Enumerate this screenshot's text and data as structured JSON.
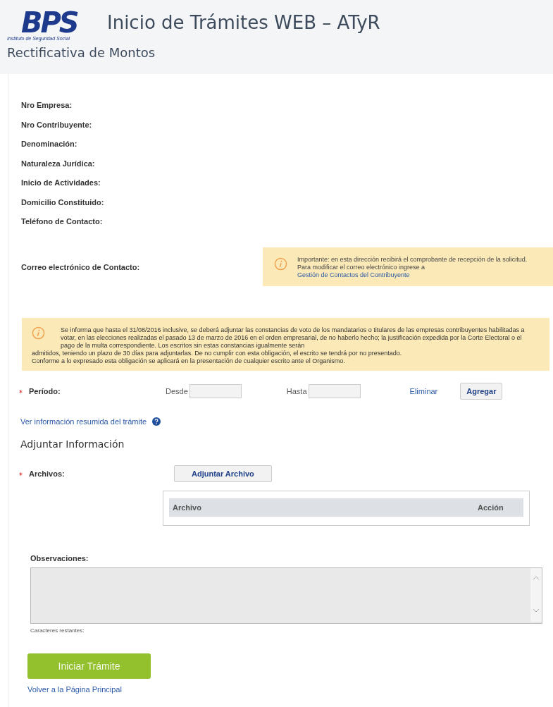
{
  "header": {
    "logo_text": "BPS",
    "logo_subtitle": "Instituto de Seguridad Social",
    "title": "Inicio de Trámites WEB – ATyR",
    "subtitle": "Rectificativa de Montos"
  },
  "fields": [
    {
      "label": "Nro Empresa:"
    },
    {
      "label": "Nro Contribuyente:"
    },
    {
      "label": "Denominación:"
    },
    {
      "label": "Naturaleza Jurídica:"
    },
    {
      "label": "Inicio de Actividades:"
    },
    {
      "label": "Domicilio Constituido:"
    },
    {
      "label": "Teléfono de Contacto:"
    }
  ],
  "email": {
    "label": "Correo electrónico de Contacto:",
    "notice": "Importante: en esta dirección recibirá el comprobante de recepción de la solicitud. Para modificar el correo electrónico ingrese a",
    "notice_link": "Gestión de Contactos del Contribuyente"
  },
  "warning": [
    "Se informa que hasta el 31/08/2016 inclusive, se deberá adjuntar las constancias de voto de los mandatarios o titulares de las empresas contribuyentes habilitadas a votar, en las elecciones realizadas el pasado 13 de marzo de 2016 en el orden empresarial, de no haberlo hecho; la justificación expedida por la Corte Electoral o el pago de la multa correspondiente. Los escritos sin estas constancias igualmente serán",
    "admitidos, teniendo un plazo de 30 días para adjuntarlas. De no cumplir con esta obligación, el escrito se tendrá por no presentado.",
    "Conforme a lo expresado esta obligación se aplicará en la presentación de cualquier escrito ante el Organismo."
  ],
  "period": {
    "required": true,
    "label": "Período:",
    "from_label": "Desde",
    "to_label": "Hasta",
    "remove_link": "Eliminar",
    "add_button": "Agregar"
  },
  "summary_link": "Ver información resumida del trámite",
  "section_title": "Adjuntar Información",
  "files": {
    "required": true,
    "label": "Archivos:",
    "attach_button": "Adjuntar Archivo",
    "columns": [
      "Archivo",
      "Acción"
    ]
  },
  "observations": {
    "label": "Observaciones:",
    "hint": "Caracteres restantes:"
  },
  "submit_button": "Iniciar Trámite",
  "back_link": "Volver a la Página Principal"
}
